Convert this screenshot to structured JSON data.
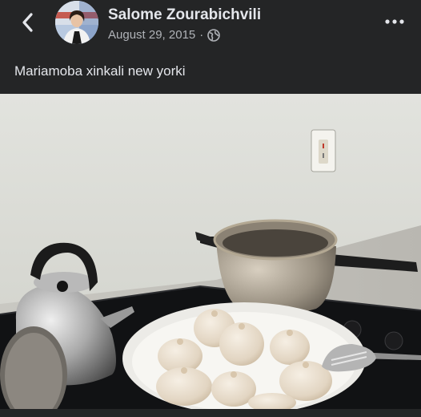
{
  "post": {
    "author_name": "Salome Zourabichvili",
    "date": "August 29, 2015",
    "separator": "·",
    "privacy_icon": "globe-icon",
    "caption": "Mariamoba xinkali new yorki"
  },
  "icons": {
    "back": "chevron-left-icon",
    "more": "more-horizontal-icon"
  },
  "colors": {
    "background": "#242526",
    "primary_text": "#e4e6eb",
    "secondary_text": "#b0b3b8"
  }
}
